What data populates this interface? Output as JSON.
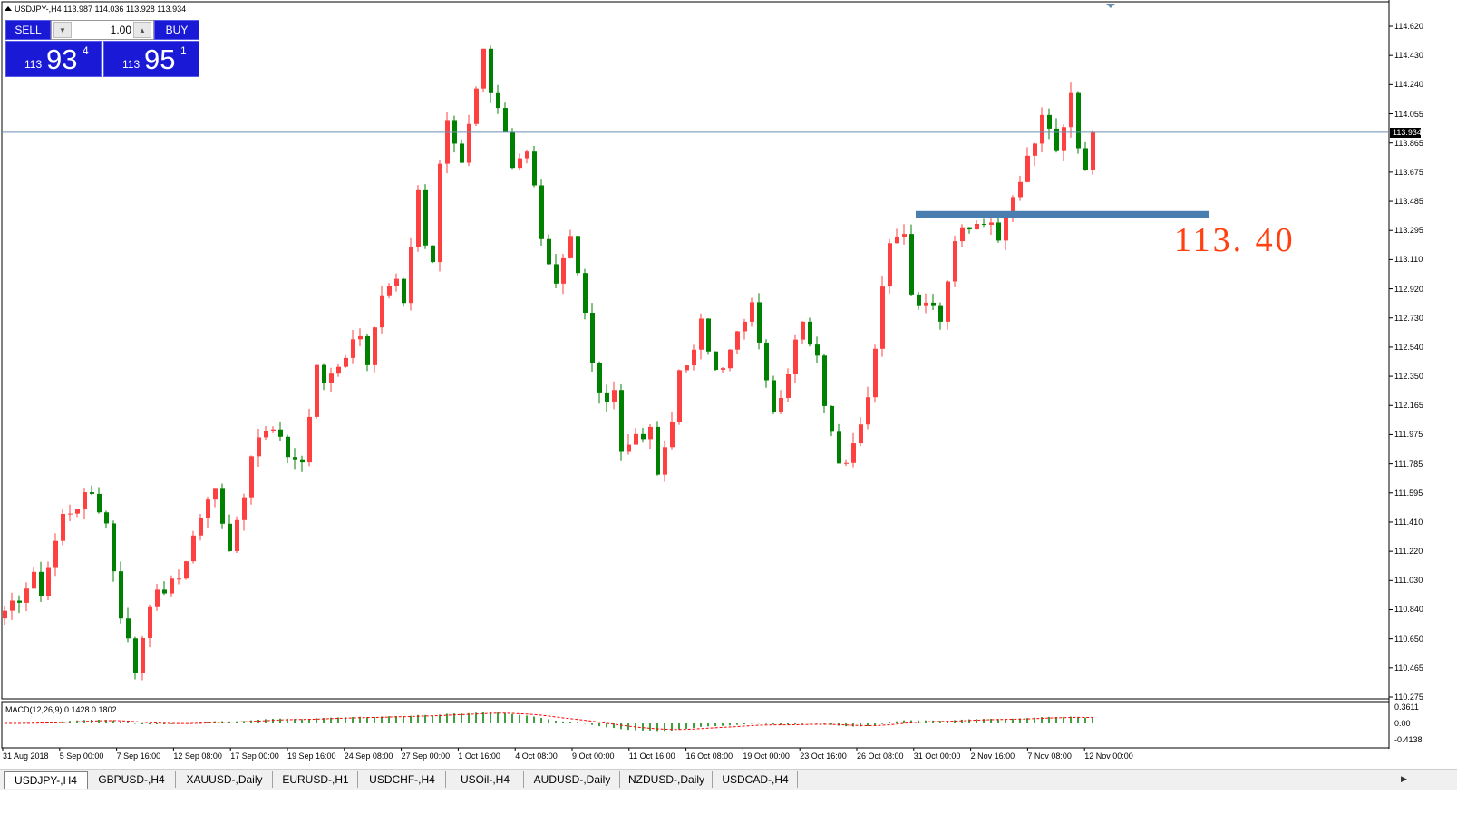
{
  "header": {
    "text": "USDJPY-,H4  113.987 114.036 113.928 113.934"
  },
  "order_panel": {
    "sell_label": "SELL",
    "buy_label": "BUY",
    "lot_value": "1.00",
    "sell_price": {
      "prefix": "113",
      "big": "93",
      "sup": "4"
    },
    "buy_price": {
      "prefix": "113",
      "big": "95",
      "sup": "1"
    }
  },
  "annotation": {
    "label": "113. 40",
    "level": 113.4,
    "color": "#4a7db0"
  },
  "current_price": "113.934",
  "price_axis": [
    "114.620",
    "114.430",
    "114.240",
    "114.055",
    "113.865",
    "113.675",
    "113.485",
    "113.295",
    "113.110",
    "112.920",
    "112.730",
    "112.540",
    "112.350",
    "112.165",
    "111.975",
    "111.785",
    "111.595",
    "111.410",
    "111.220",
    "111.030",
    "110.840",
    "110.650",
    "110.465",
    "110.275"
  ],
  "macd": {
    "label": "MACD(12,26,9) 0.1428 0.1802",
    "axis": [
      "0.3611",
      "0.00",
      "-0.4138"
    ]
  },
  "time_axis": [
    "31 Aug 2018",
    "5 Sep 00:00",
    "7 Sep 16:00",
    "12 Sep 08:00",
    "17 Sep 00:00",
    "19 Sep 16:00",
    "24 Sep 08:00",
    "27 Sep 00:00",
    "1 Oct 16:00",
    "4 Oct 08:00",
    "9 Oct 00:00",
    "11 Oct 16:00",
    "16 Oct 08:00",
    "19 Oct 00:00",
    "23 Oct 16:00",
    "26 Oct 08:00",
    "31 Oct 00:00",
    "2 Nov 16:00",
    "7 Nov 08:00",
    "12 Nov 00:00"
  ],
  "tabs": [
    "USDJPY-,H4",
    "GBPUSD-,H4",
    "XAUUSD-,Daily",
    "EURUSD-,H1",
    "USDCHF-,H4",
    "USOil-,H4",
    "AUDUSD-,Daily",
    "NZDUSD-,Daily",
    "USDCAD-,H4"
  ],
  "colors": {
    "bull": "#ff4040",
    "bear": "#008000",
    "signal": "#ff0000",
    "level_line": "#6a8fb5",
    "panel_blue": "#1a1ad6"
  },
  "chart_data": {
    "type": "candlestick",
    "symbol": "USDJPY-",
    "timeframe": "H4",
    "x_start": "31 Aug 2018",
    "x_end": "13 Nov 2018",
    "ylim": [
      110.275,
      114.62
    ],
    "path_close": [
      [
        0,
        110.8
      ],
      [
        4,
        111.05
      ],
      [
        5,
        110.96
      ],
      [
        8,
        111.45
      ],
      [
        12,
        111.6
      ],
      [
        14,
        111.4
      ],
      [
        16,
        110.82
      ],
      [
        18,
        110.45
      ],
      [
        20,
        110.9
      ],
      [
        24,
        111.05
      ],
      [
        27,
        111.45
      ],
      [
        29,
        111.62
      ],
      [
        31,
        111.25
      ],
      [
        35,
        111.97
      ],
      [
        37,
        112.0
      ],
      [
        39,
        111.85
      ],
      [
        41,
        111.8
      ],
      [
        43,
        112.4
      ],
      [
        44,
        112.32
      ],
      [
        47,
        112.5
      ],
      [
        49,
        112.65
      ],
      [
        50,
        112.45
      ],
      [
        52,
        112.85
      ],
      [
        54,
        112.95
      ],
      [
        55,
        112.8
      ],
      [
        57,
        113.55
      ],
      [
        58,
        113.2
      ],
      [
        59,
        113.05
      ],
      [
        60,
        113.75
      ],
      [
        61,
        114.03
      ],
      [
        63,
        113.75
      ],
      [
        65,
        114.2
      ],
      [
        66,
        114.5
      ],
      [
        67,
        114.15
      ],
      [
        69,
        113.95
      ],
      [
        70,
        113.7
      ],
      [
        72,
        113.85
      ],
      [
        74,
        113.25
      ],
      [
        75,
        113.05
      ],
      [
        76,
        112.95
      ],
      [
        78,
        113.3
      ],
      [
        79,
        113.0
      ],
      [
        82,
        112.2
      ],
      [
        84,
        112.25
      ],
      [
        85,
        111.85
      ],
      [
        87,
        111.95
      ],
      [
        89,
        112.0
      ],
      [
        90,
        111.75
      ],
      [
        91,
        111.85
      ],
      [
        93,
        112.35
      ],
      [
        95,
        112.5
      ],
      [
        96,
        112.7
      ],
      [
        98,
        112.4
      ],
      [
        99,
        112.45
      ],
      [
        101,
        112.65
      ],
      [
        103,
        112.85
      ],
      [
        104,
        112.6
      ],
      [
        106,
        112.1
      ],
      [
        108,
        112.4
      ],
      [
        110,
        112.7
      ],
      [
        112,
        112.5
      ],
      [
        113,
        112.2
      ],
      [
        115,
        111.8
      ],
      [
        116,
        111.75
      ],
      [
        117,
        111.9
      ],
      [
        119,
        112.2
      ],
      [
        121,
        112.9
      ],
      [
        122,
        113.2
      ],
      [
        124,
        113.3
      ],
      [
        125,
        112.9
      ],
      [
        127,
        112.8
      ],
      [
        128,
        112.85
      ],
      [
        129,
        112.75
      ],
      [
        131,
        113.25
      ],
      [
        133,
        113.3
      ],
      [
        134,
        113.35
      ],
      [
        136,
        113.35
      ],
      [
        137,
        113.2
      ],
      [
        138,
        113.4
      ],
      [
        140,
        113.65
      ],
      [
        142,
        113.85
      ],
      [
        143,
        114.05
      ],
      [
        145,
        113.8
      ],
      [
        147,
        114.15
      ],
      [
        148,
        113.8
      ],
      [
        149,
        113.7
      ],
      [
        150,
        113.934
      ]
    ]
  }
}
